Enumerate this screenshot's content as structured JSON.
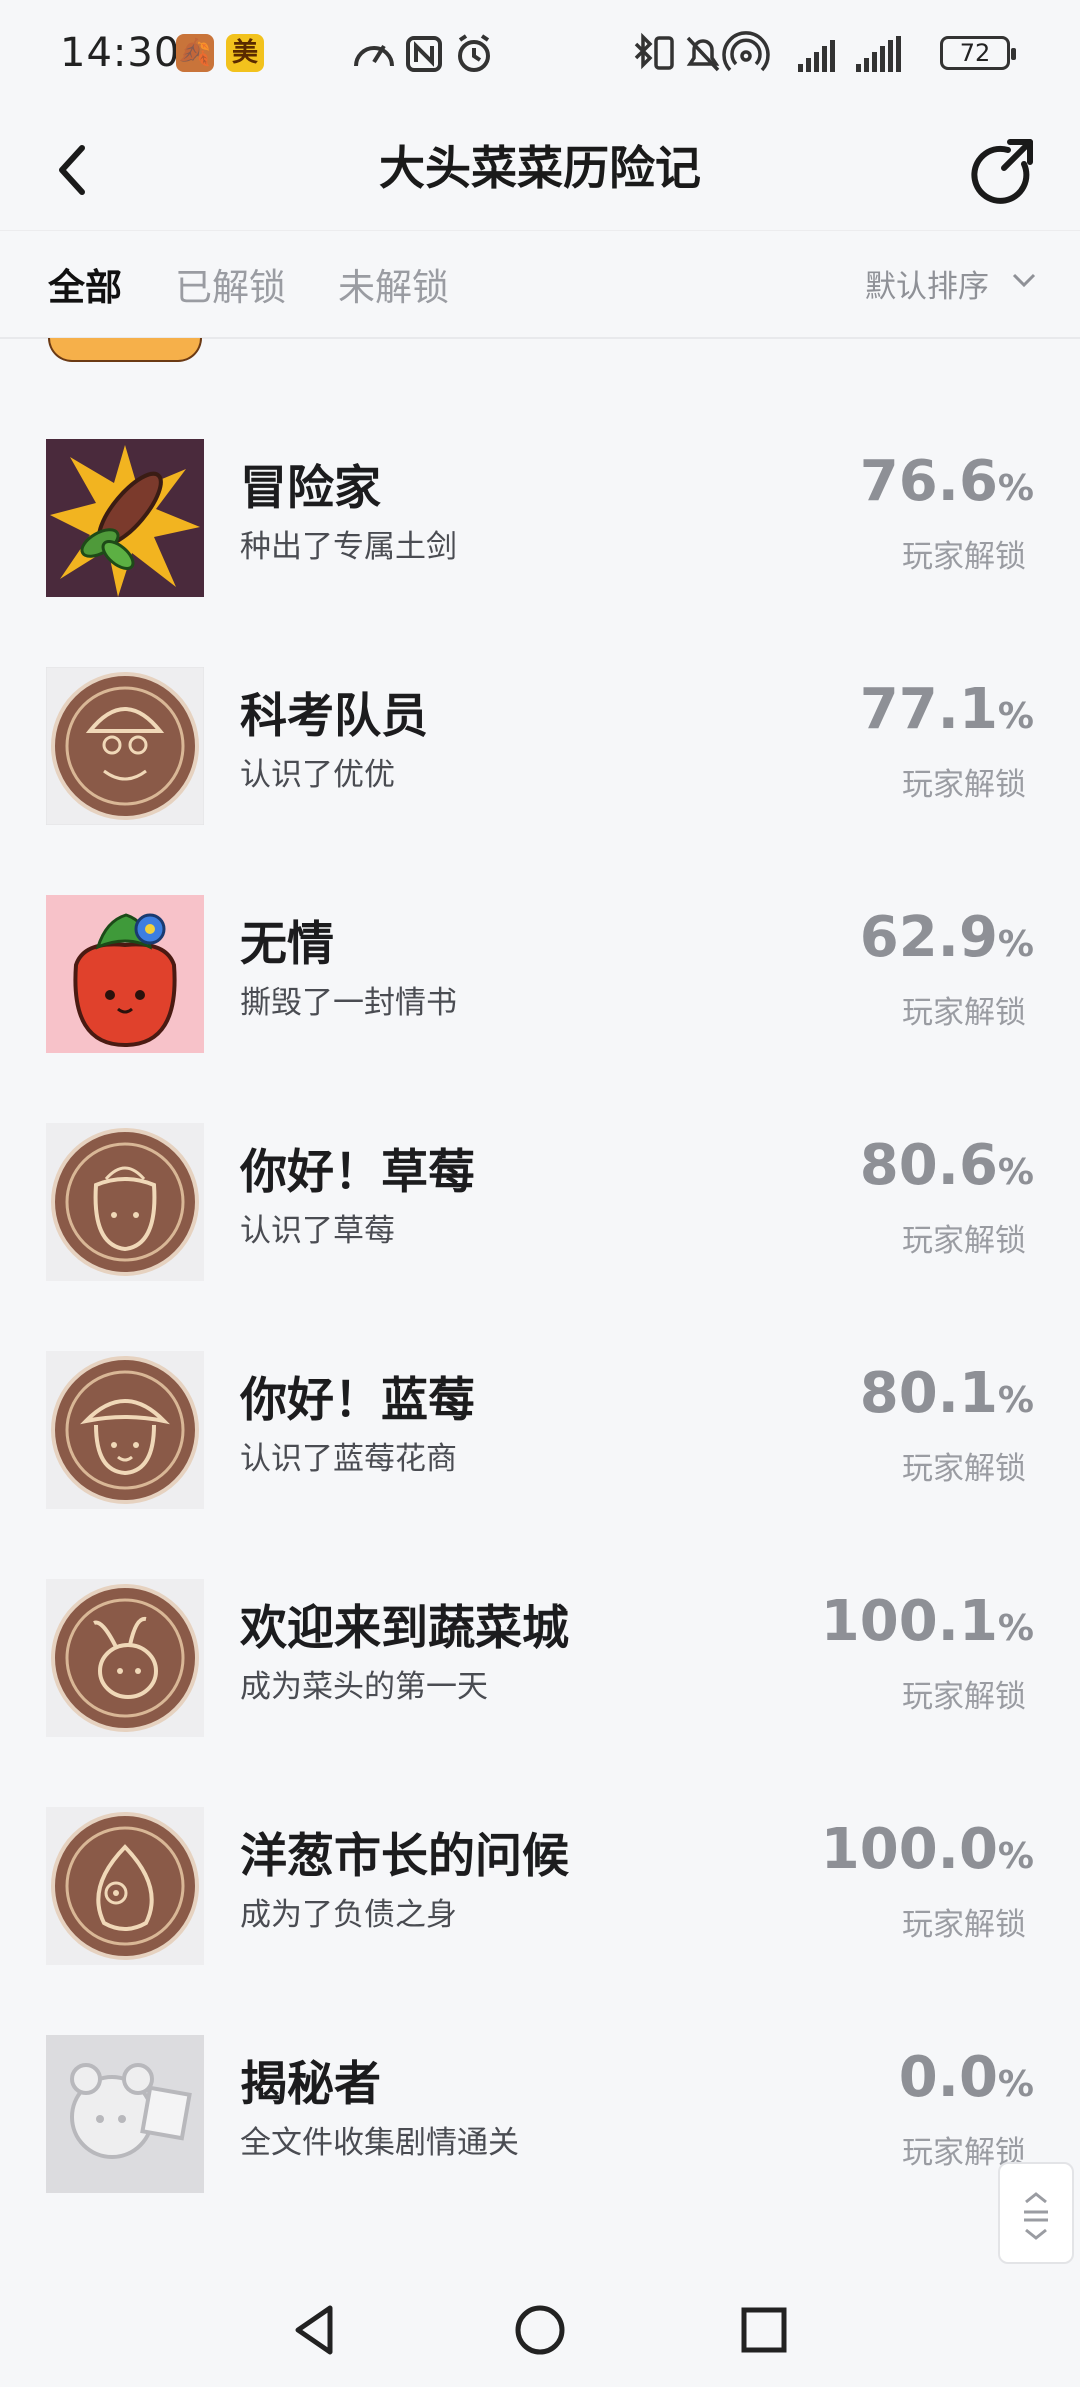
{
  "status_bar": {
    "time": "14:30",
    "app_badge_1": "🍂",
    "app_badge_2": "美",
    "battery": "72",
    "icons": [
      "speedometer-icon",
      "nfc-icon",
      "alarm-icon",
      "bluetooth-icon",
      "vibrate-icon",
      "mute-icon",
      "hotspot-icon",
      "signal-icon",
      "signal-icon-2",
      "battery-icon"
    ]
  },
  "header": {
    "title": "大头菜菜历险记"
  },
  "tabs": [
    {
      "label": "全部",
      "active": true
    },
    {
      "label": "已解锁",
      "active": false
    },
    {
      "label": "未解锁",
      "active": false
    }
  ],
  "sort": {
    "label": "默认排序"
  },
  "achievements": [
    {
      "name": "冒险家",
      "desc": "种出了专属土剑",
      "percent": "76.6",
      "unit": "%",
      "caption": "玩家解锁",
      "icon": "sword-sprout-icon"
    },
    {
      "name": "科考队员",
      "desc": "认识了优优",
      "percent": "77.1",
      "unit": "%",
      "caption": "玩家解锁",
      "icon": "explorer-medal-icon"
    },
    {
      "name": "无情",
      "desc": "撕毁了一封情书",
      "percent": "62.9",
      "unit": "%",
      "caption": "玩家解锁",
      "icon": "strawberry-icon"
    },
    {
      "name": "你好！草莓",
      "desc": "认识了草莓",
      "percent": "80.6",
      "unit": "%",
      "caption": "玩家解锁",
      "icon": "strawberry-medal-icon"
    },
    {
      "name": "你好！蓝莓",
      "desc": "认识了蓝莓花商",
      "percent": "80.1",
      "unit": "%",
      "caption": "玩家解锁",
      "icon": "blueberry-medal-icon"
    },
    {
      "name": "欢迎来到蔬菜城",
      "desc": "成为菜头的第一天",
      "percent": "100.1",
      "unit": "%",
      "caption": "玩家解锁",
      "icon": "turnip-medal-icon"
    },
    {
      "name": "洋葱市长的问候",
      "desc": "成为了负债之身",
      "percent": "100.0",
      "unit": "%",
      "caption": "玩家解锁",
      "icon": "onion-medal-icon"
    },
    {
      "name": "揭秘者",
      "desc": "全文件收集剧情通关",
      "percent": "0.0",
      "unit": "%",
      "caption": "玩家解锁",
      "icon": "locked-secret-icon"
    }
  ]
}
